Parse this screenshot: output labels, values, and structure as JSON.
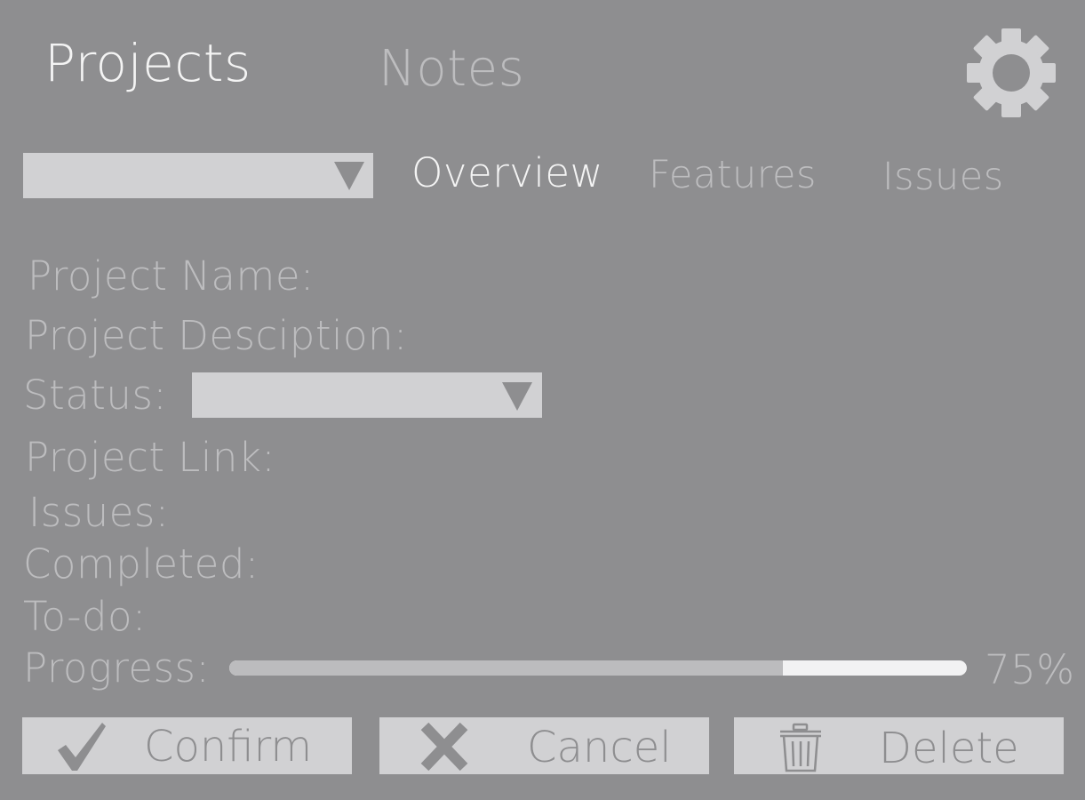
{
  "nav": {
    "projects_label": "Projects",
    "notes_label": "Notes",
    "settings_icon": "gear-icon"
  },
  "project_select": {
    "value": "",
    "icon": "caret-down-icon"
  },
  "tabs": [
    {
      "label": "Overview",
      "active": true
    },
    {
      "label": "Features",
      "active": false
    },
    {
      "label": "Issues",
      "active": false
    }
  ],
  "fields": {
    "project_name_label": "Project Name:",
    "project_description_label": "Project Desciption:",
    "status_label": "Status:",
    "status_value": "",
    "project_link_label": "Project Link:",
    "issues_label": "Issues:",
    "completed_label": "Completed:",
    "todo_label": "To-do:",
    "progress_label": "Progress:"
  },
  "progress": {
    "percent": 75,
    "text": "75%"
  },
  "buttons": {
    "confirm_label": "Confirm",
    "confirm_icon": "checkmark-icon",
    "cancel_label": "Cancel",
    "cancel_icon": "x-icon",
    "delete_label": "Delete",
    "delete_icon": "trash-icon"
  },
  "colors": {
    "background": "#8e8e90",
    "control": "#d1d1d3",
    "active_text": "#f4f4f4",
    "inactive_text": "#bdbdbf",
    "progress_fill": "#bcbcbe",
    "progress_track": "#f2f2f3"
  }
}
